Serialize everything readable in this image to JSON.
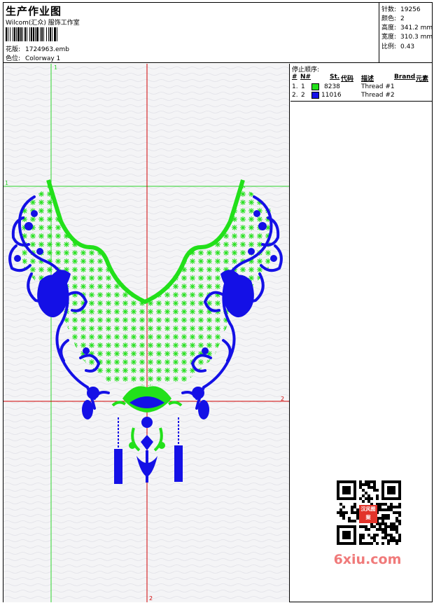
{
  "header": {
    "title": "生产作业图",
    "company": "Wilcom(汇众) 服饰工作室",
    "design_label": "花版:",
    "design_value": "1724963.emb",
    "colorway_label": "色位:",
    "colorway_value": "Colorway 1"
  },
  "stats": [
    {
      "label": "针数:",
      "value": "19256"
    },
    {
      "label": "颜色:",
      "value": "2"
    },
    {
      "label": "高度:",
      "value": "341.2 mm"
    },
    {
      "label": "宽度:",
      "value": "310.3 mm"
    },
    {
      "label": "比例:",
      "value": "0.43"
    }
  ],
  "stop_sequence": {
    "title": "停止顺序:",
    "columns": [
      "#",
      "N#",
      "St.",
      "代码",
      "描述",
      "Brand",
      "元素"
    ],
    "rows": [
      {
        "index": "1.",
        "n": "1",
        "color": "#22e01a",
        "code": "8238",
        "description": "Thread #1"
      },
      {
        "index": "2.",
        "n": "2",
        "color": "#1410e6",
        "code": "11016",
        "description": "Thread #2"
      }
    ]
  },
  "guides": {
    "v1_label": "1",
    "h1_label": "1",
    "h2_label": "2",
    "v2_label": "2",
    "green_color": "#2cd42c",
    "red_color": "#d00000"
  },
  "design_colors": {
    "thread1": "#22e01a",
    "thread2": "#1410e6"
  },
  "watermark": {
    "badge_text": "汉风图案",
    "site": "6xiu.com"
  }
}
